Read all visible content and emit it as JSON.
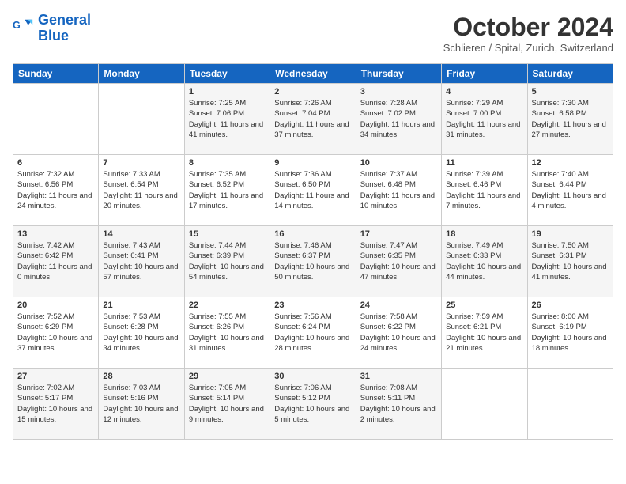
{
  "logo": {
    "line1": "General",
    "line2": "Blue"
  },
  "title": "October 2024",
  "subtitle": "Schlieren / Spital, Zurich, Switzerland",
  "days_of_week": [
    "Sunday",
    "Monday",
    "Tuesday",
    "Wednesday",
    "Thursday",
    "Friday",
    "Saturday"
  ],
  "weeks": [
    [
      {
        "day": null
      },
      {
        "day": null
      },
      {
        "day": 1,
        "sunrise": "Sunrise: 7:25 AM",
        "sunset": "Sunset: 7:06 PM",
        "daylight": "Daylight: 11 hours and 41 minutes."
      },
      {
        "day": 2,
        "sunrise": "Sunrise: 7:26 AM",
        "sunset": "Sunset: 7:04 PM",
        "daylight": "Daylight: 11 hours and 37 minutes."
      },
      {
        "day": 3,
        "sunrise": "Sunrise: 7:28 AM",
        "sunset": "Sunset: 7:02 PM",
        "daylight": "Daylight: 11 hours and 34 minutes."
      },
      {
        "day": 4,
        "sunrise": "Sunrise: 7:29 AM",
        "sunset": "Sunset: 7:00 PM",
        "daylight": "Daylight: 11 hours and 31 minutes."
      },
      {
        "day": 5,
        "sunrise": "Sunrise: 7:30 AM",
        "sunset": "Sunset: 6:58 PM",
        "daylight": "Daylight: 11 hours and 27 minutes."
      }
    ],
    [
      {
        "day": 6,
        "sunrise": "Sunrise: 7:32 AM",
        "sunset": "Sunset: 6:56 PM",
        "daylight": "Daylight: 11 hours and 24 minutes."
      },
      {
        "day": 7,
        "sunrise": "Sunrise: 7:33 AM",
        "sunset": "Sunset: 6:54 PM",
        "daylight": "Daylight: 11 hours and 20 minutes."
      },
      {
        "day": 8,
        "sunrise": "Sunrise: 7:35 AM",
        "sunset": "Sunset: 6:52 PM",
        "daylight": "Daylight: 11 hours and 17 minutes."
      },
      {
        "day": 9,
        "sunrise": "Sunrise: 7:36 AM",
        "sunset": "Sunset: 6:50 PM",
        "daylight": "Daylight: 11 hours and 14 minutes."
      },
      {
        "day": 10,
        "sunrise": "Sunrise: 7:37 AM",
        "sunset": "Sunset: 6:48 PM",
        "daylight": "Daylight: 11 hours and 10 minutes."
      },
      {
        "day": 11,
        "sunrise": "Sunrise: 7:39 AM",
        "sunset": "Sunset: 6:46 PM",
        "daylight": "Daylight: 11 hours and 7 minutes."
      },
      {
        "day": 12,
        "sunrise": "Sunrise: 7:40 AM",
        "sunset": "Sunset: 6:44 PM",
        "daylight": "Daylight: 11 hours and 4 minutes."
      }
    ],
    [
      {
        "day": 13,
        "sunrise": "Sunrise: 7:42 AM",
        "sunset": "Sunset: 6:42 PM",
        "daylight": "Daylight: 11 hours and 0 minutes."
      },
      {
        "day": 14,
        "sunrise": "Sunrise: 7:43 AM",
        "sunset": "Sunset: 6:41 PM",
        "daylight": "Daylight: 10 hours and 57 minutes."
      },
      {
        "day": 15,
        "sunrise": "Sunrise: 7:44 AM",
        "sunset": "Sunset: 6:39 PM",
        "daylight": "Daylight: 10 hours and 54 minutes."
      },
      {
        "day": 16,
        "sunrise": "Sunrise: 7:46 AM",
        "sunset": "Sunset: 6:37 PM",
        "daylight": "Daylight: 10 hours and 50 minutes."
      },
      {
        "day": 17,
        "sunrise": "Sunrise: 7:47 AM",
        "sunset": "Sunset: 6:35 PM",
        "daylight": "Daylight: 10 hours and 47 minutes."
      },
      {
        "day": 18,
        "sunrise": "Sunrise: 7:49 AM",
        "sunset": "Sunset: 6:33 PM",
        "daylight": "Daylight: 10 hours and 44 minutes."
      },
      {
        "day": 19,
        "sunrise": "Sunrise: 7:50 AM",
        "sunset": "Sunset: 6:31 PM",
        "daylight": "Daylight: 10 hours and 41 minutes."
      }
    ],
    [
      {
        "day": 20,
        "sunrise": "Sunrise: 7:52 AM",
        "sunset": "Sunset: 6:29 PM",
        "daylight": "Daylight: 10 hours and 37 minutes."
      },
      {
        "day": 21,
        "sunrise": "Sunrise: 7:53 AM",
        "sunset": "Sunset: 6:28 PM",
        "daylight": "Daylight: 10 hours and 34 minutes."
      },
      {
        "day": 22,
        "sunrise": "Sunrise: 7:55 AM",
        "sunset": "Sunset: 6:26 PM",
        "daylight": "Daylight: 10 hours and 31 minutes."
      },
      {
        "day": 23,
        "sunrise": "Sunrise: 7:56 AM",
        "sunset": "Sunset: 6:24 PM",
        "daylight": "Daylight: 10 hours and 28 minutes."
      },
      {
        "day": 24,
        "sunrise": "Sunrise: 7:58 AM",
        "sunset": "Sunset: 6:22 PM",
        "daylight": "Daylight: 10 hours and 24 minutes."
      },
      {
        "day": 25,
        "sunrise": "Sunrise: 7:59 AM",
        "sunset": "Sunset: 6:21 PM",
        "daylight": "Daylight: 10 hours and 21 minutes."
      },
      {
        "day": 26,
        "sunrise": "Sunrise: 8:00 AM",
        "sunset": "Sunset: 6:19 PM",
        "daylight": "Daylight: 10 hours and 18 minutes."
      }
    ],
    [
      {
        "day": 27,
        "sunrise": "Sunrise: 7:02 AM",
        "sunset": "Sunset: 5:17 PM",
        "daylight": "Daylight: 10 hours and 15 minutes."
      },
      {
        "day": 28,
        "sunrise": "Sunrise: 7:03 AM",
        "sunset": "Sunset: 5:16 PM",
        "daylight": "Daylight: 10 hours and 12 minutes."
      },
      {
        "day": 29,
        "sunrise": "Sunrise: 7:05 AM",
        "sunset": "Sunset: 5:14 PM",
        "daylight": "Daylight: 10 hours and 9 minutes."
      },
      {
        "day": 30,
        "sunrise": "Sunrise: 7:06 AM",
        "sunset": "Sunset: 5:12 PM",
        "daylight": "Daylight: 10 hours and 5 minutes."
      },
      {
        "day": 31,
        "sunrise": "Sunrise: 7:08 AM",
        "sunset": "Sunset: 5:11 PM",
        "daylight": "Daylight: 10 hours and 2 minutes."
      },
      {
        "day": null
      },
      {
        "day": null
      }
    ]
  ]
}
